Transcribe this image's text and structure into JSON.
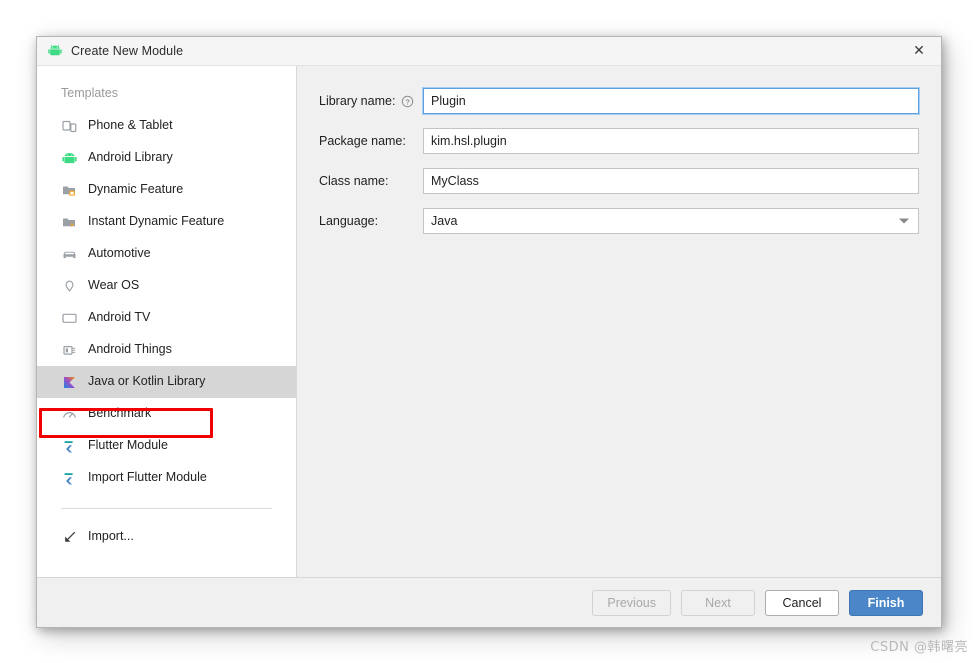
{
  "window": {
    "title": "Create New Module",
    "title_icon": "android-icon",
    "close_label": "✕"
  },
  "sidebar": {
    "section_label": "Templates",
    "items": [
      {
        "label": "Phone & Tablet",
        "icon": "phone-tablet-icon",
        "selected": false
      },
      {
        "label": "Android Library",
        "icon": "android-icon",
        "selected": false
      },
      {
        "label": "Dynamic Feature",
        "icon": "dynamic-feature-icon",
        "selected": false
      },
      {
        "label": "Instant Dynamic Feature",
        "icon": "instant-dynamic-feature-icon",
        "selected": false
      },
      {
        "label": "Automotive",
        "icon": "car-icon",
        "selected": false
      },
      {
        "label": "Wear OS",
        "icon": "watch-icon",
        "selected": false
      },
      {
        "label": "Android TV",
        "icon": "tv-icon",
        "selected": false
      },
      {
        "label": "Android Things",
        "icon": "things-icon",
        "selected": false
      },
      {
        "label": "Java or Kotlin Library",
        "icon": "kotlin-icon",
        "selected": true
      },
      {
        "label": "Benchmark",
        "icon": "benchmark-icon",
        "selected": false
      },
      {
        "label": "Flutter Module",
        "icon": "flutter-icon",
        "selected": false
      },
      {
        "label": "Import Flutter Module",
        "icon": "flutter-icon",
        "selected": false
      }
    ],
    "import_item": {
      "label": "Import...",
      "icon": "import-icon"
    }
  },
  "form": {
    "fields": [
      {
        "label": "Library name:",
        "value": "Plugin",
        "type": "text",
        "focused": true,
        "help": true,
        "name": "library-name"
      },
      {
        "label": "Package name:",
        "value": "kim.hsl.plugin",
        "type": "text",
        "focused": false,
        "help": false,
        "name": "package-name"
      },
      {
        "label": "Class name:",
        "value": "MyClass",
        "type": "text",
        "focused": false,
        "help": false,
        "name": "class-name"
      },
      {
        "label": "Language:",
        "value": "Java",
        "type": "combo",
        "focused": false,
        "help": false,
        "name": "language"
      }
    ]
  },
  "footer": {
    "buttons": [
      {
        "label": "Previous",
        "state": "disabled",
        "name": "previous-button"
      },
      {
        "label": "Next",
        "state": "disabled",
        "name": "next-button"
      },
      {
        "label": "Cancel",
        "state": "normal",
        "name": "cancel-button"
      },
      {
        "label": "Finish",
        "state": "primary",
        "name": "finish-button"
      }
    ]
  },
  "watermark": {
    "text": "CSDN @韩曙亮"
  },
  "colors": {
    "accent": "#4a86c8",
    "selection": "#d6d6d6",
    "annotation": "#f00000",
    "panel": "#f0f0f0",
    "focus_border": "#5e9fe0"
  }
}
